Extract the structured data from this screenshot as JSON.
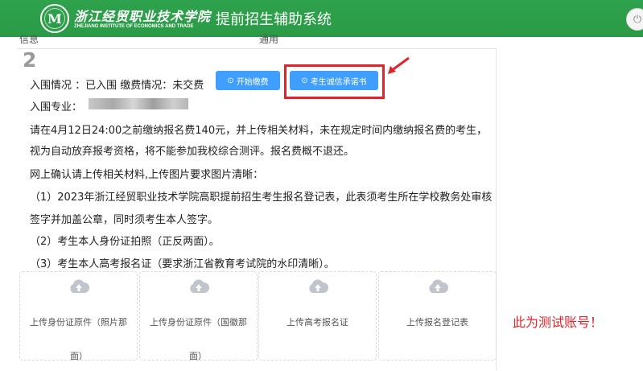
{
  "header": {
    "school_name_cn": "浙江经贸职业技术学院",
    "school_name_en": "ZHEJIANG INSTITUTE OF ECONOMICS AND TRADE",
    "system_title": "提前招生辅助系统",
    "bg_color": "#2ea44f",
    "power_icon": "power-icon"
  },
  "prev_row": {
    "left_text": "信息",
    "right_text": "通用"
  },
  "record": {
    "index": "2",
    "status_line": "入围情况 ：已入围   缴费情况：未交费",
    "pay_button": "开始缴费",
    "pledge_button": "考生诚信承诺书",
    "major_label": "入围专业：",
    "notice": [
      "请在4月12日24:00之前缴纳报名费140元，并上传相关材料，未在规定时间内缴纳报名费的考生，",
      "视为自动放弃报考资格，将不能参加我校综合测评。报名费概不退还。",
      "网上确认请上传相关材料,上传图片要求图片清晰：",
      "（1）2023年浙江经贸职业技术学院高职提前招生考生报名登记表，此表须考生所在学校教务处审核",
      "签字并加盖公章，同时须考生本人签字。",
      "（2）考生本人身份证拍照（正反两面）。",
      "（3）考生本人高考报名证（要求浙江省教育考试院的水印清晰）。"
    ],
    "uploads": [
      {
        "label": "上传身份证原件（照片那",
        "label2": "面）"
      },
      {
        "label": "上传身份证原件（国徽那",
        "label2": "面）"
      },
      {
        "label": "上传高考报名证",
        "label2": ""
      },
      {
        "label": "上传报名登记表",
        "label2": ""
      }
    ]
  },
  "annotation": {
    "note": "此为测试账号！",
    "color": "#e0242b"
  },
  "colors": {
    "primary_button": "#409eff"
  }
}
